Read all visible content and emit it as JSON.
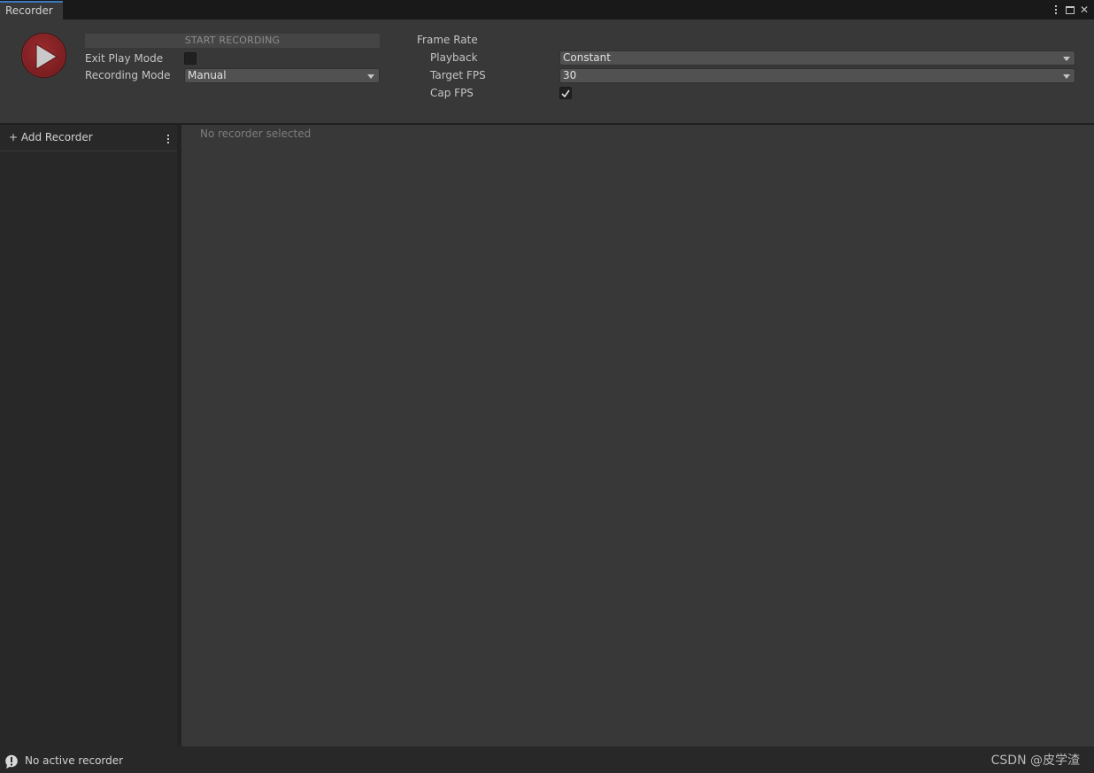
{
  "window": {
    "tab_title": "Recorder",
    "controls": [
      "more-menu",
      "maximize",
      "close"
    ],
    "close_glyph": "✕"
  },
  "top_panel": {
    "start_recording_label": "START RECORDING",
    "exit_play_mode_label": "Exit Play Mode",
    "exit_play_mode_checked": false,
    "recording_mode_label": "Recording Mode",
    "recording_mode_value": "Manual",
    "frame_rate_heading": "Frame Rate",
    "playback_label": "Playback",
    "playback_value": "Constant",
    "target_fps_label": "Target FPS",
    "target_fps_value": "30",
    "cap_fps_label": "Cap FPS",
    "cap_fps_checked": true
  },
  "sidebar": {
    "add_recorder_label": "+ Add Recorder"
  },
  "main": {
    "empty_message": "No recorder selected"
  },
  "status_bar": {
    "status_text": "No active recorder",
    "watermark": "CSDN @皮学渣"
  },
  "colors": {
    "accent_tab": "#3a79bb",
    "record_button": "#8a2326",
    "panel_bg": "#383838",
    "dark_bg": "#282828"
  },
  "icons": {
    "record": "play-triangle-icon",
    "menu": "kebab-icon",
    "status": "warning-bubble-icon"
  }
}
